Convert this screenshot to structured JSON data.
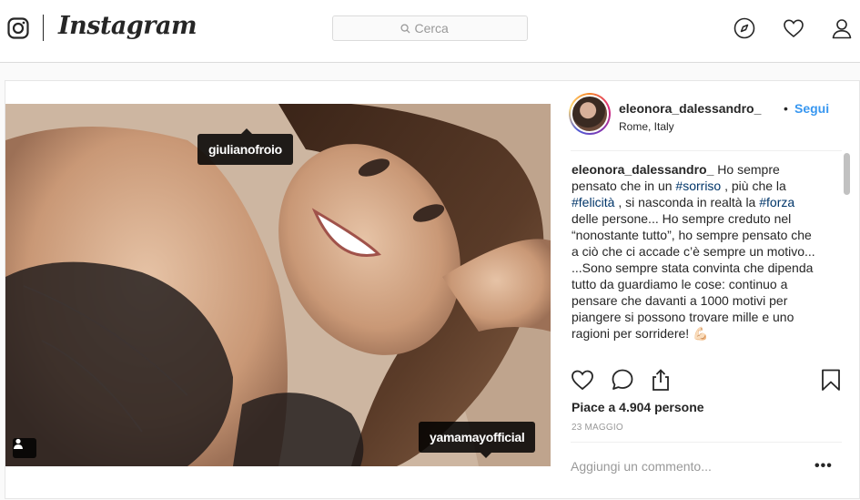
{
  "nav": {
    "wordmark": "Instagram",
    "search_placeholder": "Cerca",
    "icons": [
      "instagram-camera-icon",
      "search-icon",
      "compass-icon",
      "heart-icon",
      "profile-icon"
    ]
  },
  "post": {
    "username": "eleonora_dalessandro_",
    "separator": "•",
    "follow_label": "Segui",
    "location": "Rome, Italy",
    "tags": [
      {
        "label": "giulianofroio"
      },
      {
        "label": "yamamayofficial"
      }
    ],
    "caption": {
      "username": "eleonora_dalessandro_",
      "p1": " Ho sempre pensato che in un ",
      "h1": "#sorriso",
      "p2": " , più che la ",
      "h2": "#felicità",
      "p3": " , si nasconda in realtà la ",
      "h3": "#forza",
      "p4": " delle persone... Ho sempre creduto nel “nonostante tutto”, ho sempre pensato che a ciò che ci accade c’è sempre un motivo...",
      "p5": "...Sono sempre stata convinta che dipenda tutto da guardiamo le cose: continuo a pensare che davanti a 1000 motivi per piangere si possono trovare mille e uno ragioni per sorridere! 💪🏻"
    },
    "likes_text": "Piace a 4.904 persone",
    "date": "23 MAGGIO",
    "comment_placeholder": "Aggiungi un commento...",
    "more_label": "•••"
  },
  "colors": {
    "accent_link": "#3897f0",
    "hashtag": "#003569",
    "border": "#dbdbdb",
    "muted_text": "#999999"
  }
}
